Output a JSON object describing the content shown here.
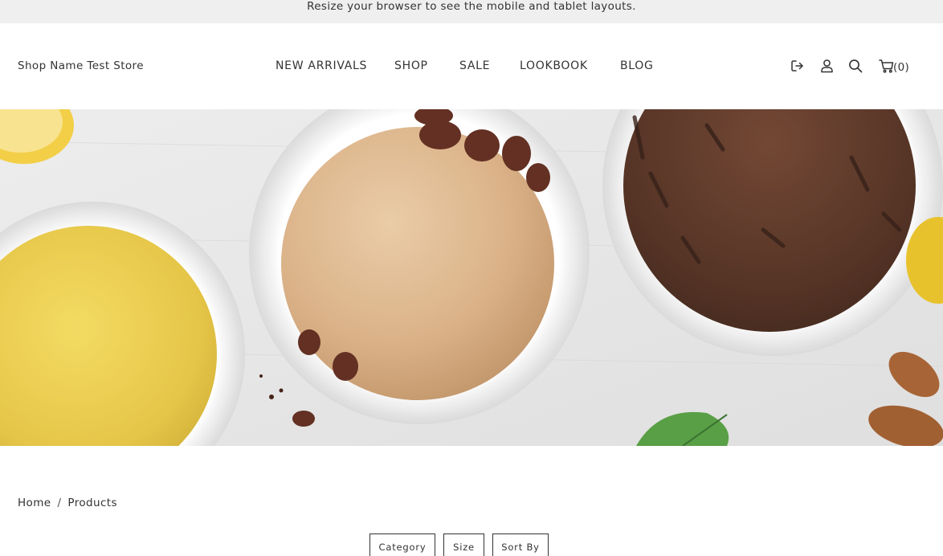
{
  "notice": "Resize your browser to see the mobile and tablet layouts.",
  "header": {
    "store_name": "Shop Name Test Store",
    "nav": [
      "NEW ARRIVALS",
      "SHOP",
      "SALE",
      "LOOKBOOK",
      "BLOG"
    ],
    "icons": [
      "logout-icon",
      "user-icon",
      "search-icon",
      "cart-icon"
    ],
    "cart_count": "(0)"
  },
  "hero": {
    "subject": "ice-cream-bowls-photo"
  },
  "breadcrumb": {
    "home": "Home",
    "separator": "/",
    "current": "Products"
  },
  "filters": {
    "category": "Category",
    "size": "Size",
    "sort": "Sort By"
  }
}
